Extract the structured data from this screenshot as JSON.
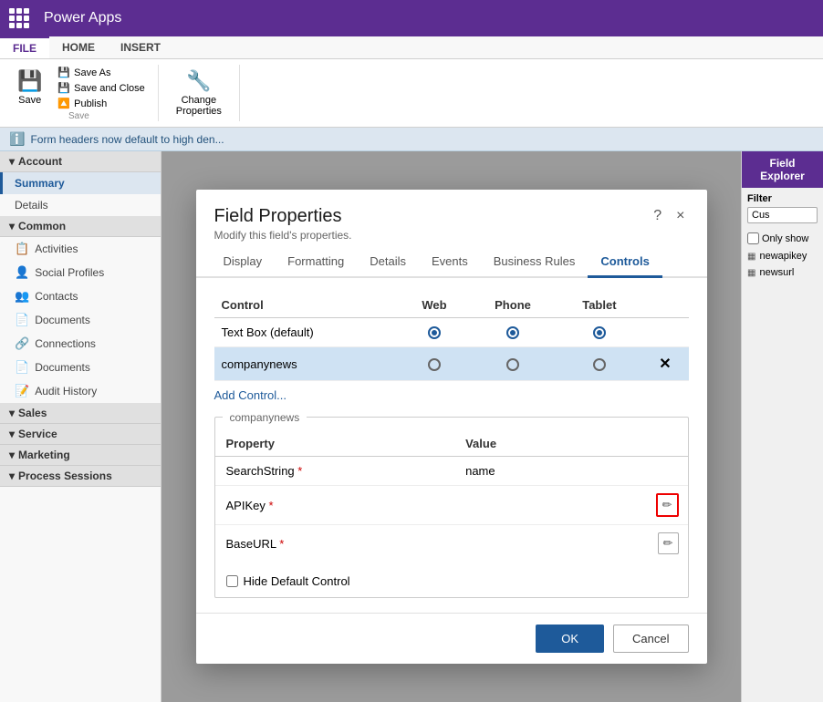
{
  "topbar": {
    "appTitle": "Power Apps",
    "appsIconLabel": "apps-grid"
  },
  "ribbon": {
    "tabs": [
      {
        "label": "FILE",
        "active": true
      },
      {
        "label": "HOME",
        "active": false
      },
      {
        "label": "INSERT",
        "active": false
      }
    ],
    "groups": {
      "save": {
        "label": "Save",
        "saveBig": "Save",
        "saveAs": "Save As",
        "saveAndClose": "Save and Close",
        "publish": "Publish"
      },
      "changeProperties": "Change\nProperties"
    }
  },
  "infoBar": {
    "message": "Form headers now default to high den..."
  },
  "sidebar": {
    "sections": [
      {
        "label": "Account",
        "items": [
          {
            "label": "Summary",
            "active": true
          },
          {
            "label": "Details",
            "active": false
          }
        ]
      },
      {
        "label": "Common",
        "items": [
          {
            "label": "Activities"
          },
          {
            "label": "Social Profiles"
          },
          {
            "label": "Contacts"
          },
          {
            "label": "Documents"
          },
          {
            "label": "Connections"
          },
          {
            "label": "Documents"
          },
          {
            "label": "Audit History"
          }
        ]
      },
      {
        "label": "Sales",
        "items": []
      },
      {
        "label": "Service",
        "items": []
      },
      {
        "label": "Marketing",
        "items": []
      },
      {
        "label": "Process Sessions",
        "items": []
      }
    ]
  },
  "fieldExplorer": {
    "title": "Field Explorer",
    "filterLabel": "Filter",
    "filterPlaceholder": "Cus",
    "onlyShowLabel": "Only show",
    "fields": [
      {
        "label": "newapikey"
      },
      {
        "label": "newsurl"
      }
    ]
  },
  "dialog": {
    "title": "Field Properties",
    "subtitle": "Modify this field's properties.",
    "helpBtn": "?",
    "closeBtn": "×",
    "tabs": [
      {
        "label": "Display"
      },
      {
        "label": "Formatting"
      },
      {
        "label": "Details"
      },
      {
        "label": "Events"
      },
      {
        "label": "Business Rules"
      },
      {
        "label": "Controls",
        "active": true
      }
    ],
    "controlsTab": {
      "tableHeaders": [
        "Control",
        "Web",
        "Phone",
        "Tablet"
      ],
      "rows": [
        {
          "name": "Text Box (default)",
          "webSelected": true,
          "phoneSelected": true,
          "tabletSelected": true,
          "selected": false
        },
        {
          "name": "companynews",
          "webSelected": false,
          "phoneSelected": false,
          "tabletSelected": false,
          "selected": true,
          "hasDelete": true
        }
      ],
      "addControlLink": "Add Control..."
    },
    "companynewsSection": {
      "sectionTitle": "companynews",
      "propertyHeaders": [
        "Property",
        "Value"
      ],
      "properties": [
        {
          "name": "SearchString",
          "required": true,
          "value": "name",
          "hasEdit": false
        },
        {
          "name": "APIKey",
          "required": true,
          "value": "",
          "hasEdit": true,
          "editHighlighted": true
        },
        {
          "name": "BaseURL",
          "required": true,
          "value": "",
          "hasEdit": true,
          "editHighlighted": false
        }
      ]
    },
    "hideDefaultControl": {
      "label": "Hide Default Control",
      "checked": false
    },
    "footer": {
      "okLabel": "OK",
      "cancelLabel": "Cancel"
    }
  }
}
